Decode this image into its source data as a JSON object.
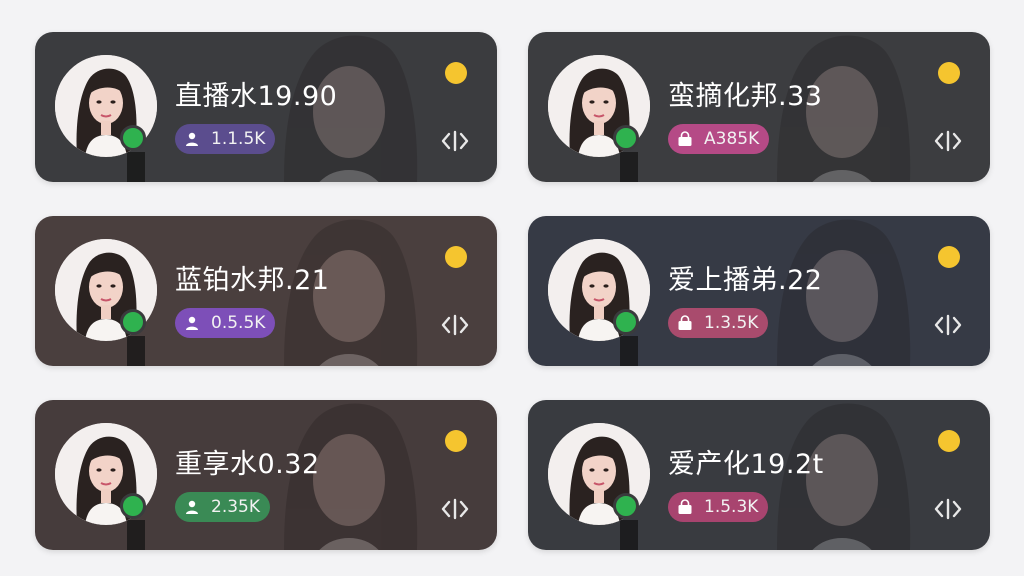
{
  "colors": {
    "status_dot": "#f5c52f",
    "online_dot": "#2fb24f"
  },
  "cards": [
    {
      "title": "直播水19.90",
      "count": "1.1.5K",
      "badge_icon": "person-icon",
      "bg": "#3b3c3f",
      "badge_bg": "#5b4d8e"
    },
    {
      "title": "蛮摘化邦.33",
      "count": "A385K",
      "badge_icon": "bag-icon",
      "bg": "#3c3d40",
      "badge_bg": "#b54a86"
    },
    {
      "title": "蓝铂水邦.21",
      "count": "0.5.5K",
      "badge_icon": "person-icon",
      "bg": "#4a3f3e",
      "badge_bg": "#7d4fb8"
    },
    {
      "title": "爱上播弟.22",
      "count": "1.3.5K",
      "badge_icon": "bag-icon",
      "bg": "#363a45",
      "badge_bg": "#a94b6d"
    },
    {
      "title": "重享水0.32",
      "count": "2.35K",
      "badge_icon": "person-icon",
      "bg": "#463c3c",
      "badge_bg": "#3a8a55"
    },
    {
      "title": "爱产化19.2t",
      "count": "1.5.3K",
      "badge_icon": "bag-icon",
      "bg": "#393b40",
      "badge_bg": "#a8446f"
    }
  ]
}
